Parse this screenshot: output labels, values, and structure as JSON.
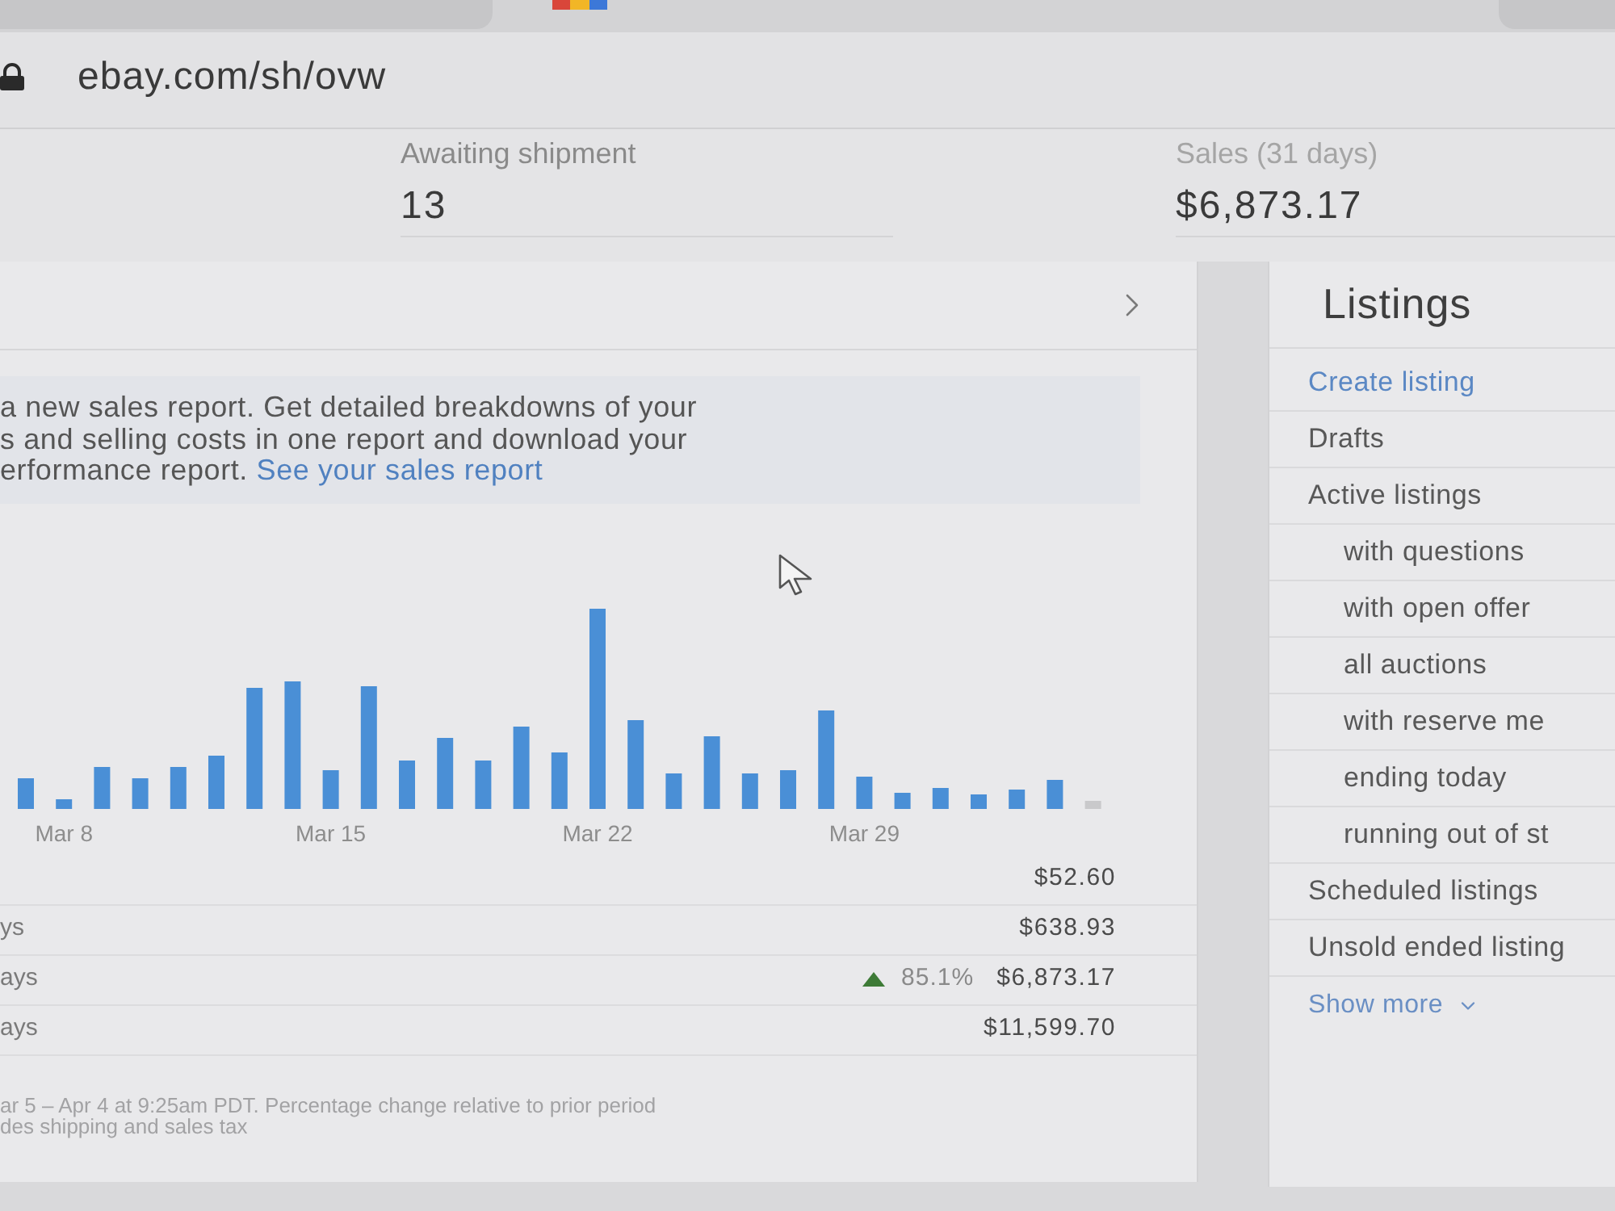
{
  "browser": {
    "url": "ebay.com/sh/ovw"
  },
  "summary": [
    {
      "label": "Awaiting shipment",
      "value": "13"
    },
    {
      "label": "Sales (31 days)",
      "value": "$6,873.17"
    }
  ],
  "sales_panel": {
    "notice": {
      "lines": [
        "a new sales report. Get detailed breakdowns of your",
        "s and selling costs in one report and download your",
        "erformance report."
      ],
      "link": "See your sales report"
    },
    "chart_labels": [
      "Mar 8",
      "Mar 15",
      "Mar 22",
      "Mar 29"
    ],
    "totals": [
      {
        "kind": "plain",
        "value": "$52.60"
      },
      {
        "kind": "plain",
        "label": "ys",
        "value": "$638.93"
      },
      {
        "kind": "rising",
        "label": "ays",
        "change": "85.1%",
        "value": "$6,873.17"
      },
      {
        "kind": "plain",
        "label": "ays",
        "value": "$11,599.70"
      }
    ],
    "footnote": [
      "ar 5 – Apr 4 at 9:25am PDT. Percentage change relative to prior period",
      "des shipping and sales tax"
    ]
  },
  "listings": {
    "title": "Listings",
    "items": [
      {
        "label": "Create listing",
        "kind": "action"
      },
      {
        "label": "Drafts",
        "kind": "item"
      },
      {
        "label": "Active listings",
        "kind": "item",
        "children": [
          {
            "label": "with questions",
            "kind": "item"
          },
          {
            "label": "with open offer",
            "kind": "item"
          },
          {
            "label": "all auctions",
            "kind": "item"
          },
          {
            "label": "with reserve me",
            "kind": "item"
          },
          {
            "label": "ending today",
            "kind": "item"
          },
          {
            "label": "running out of st",
            "kind": "item"
          }
        ]
      },
      {
        "label": "Scheduled listings",
        "kind": "item"
      },
      {
        "label": "Unsold ended listing",
        "kind": "item"
      }
    ],
    "show_more": "Show more"
  }
}
